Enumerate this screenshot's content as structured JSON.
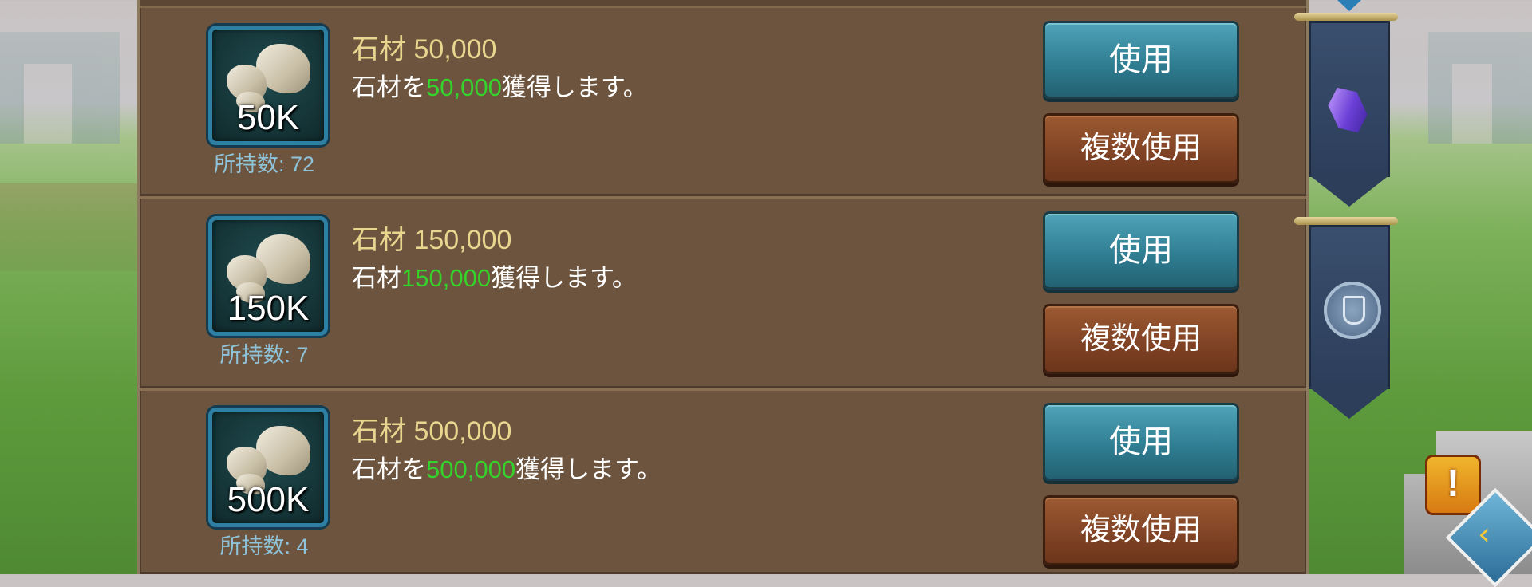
{
  "items": [
    {
      "icon_qty": "50K",
      "owned": "所持数: 72",
      "title": "石材 50,000",
      "desc_pre": "石材を",
      "desc_amount": "50,000",
      "desc_post": "獲得します。",
      "use_label": "使用",
      "multi_use_label": "複数使用"
    },
    {
      "icon_qty": "150K",
      "owned": "所持数: 7",
      "title": "石材 150,000",
      "desc_pre": "石材",
      "desc_amount": "150,000",
      "desc_post": "獲得します。",
      "use_label": "使用",
      "multi_use_label": "複数使用"
    },
    {
      "icon_qty": "500K",
      "owned": "所持数: 4",
      "title": "石材 500,000",
      "desc_pre": "石材を",
      "desc_amount": "500,000",
      "desc_post": "獲得します。",
      "use_label": "使用",
      "multi_use_label": "複数使用"
    }
  ],
  "side_tabs": [
    {
      "icon": "gem-icon"
    },
    {
      "icon": "shield-icon"
    }
  ],
  "alert_badge": "!",
  "nav_arrow": "‹",
  "colors": {
    "title": "#e8d68f",
    "highlight": "#35d22b",
    "owned": "#8fc3da",
    "use_button": "#2e7b8f",
    "multi_use_button": "#7f4224",
    "panel": "#6d543e"
  }
}
